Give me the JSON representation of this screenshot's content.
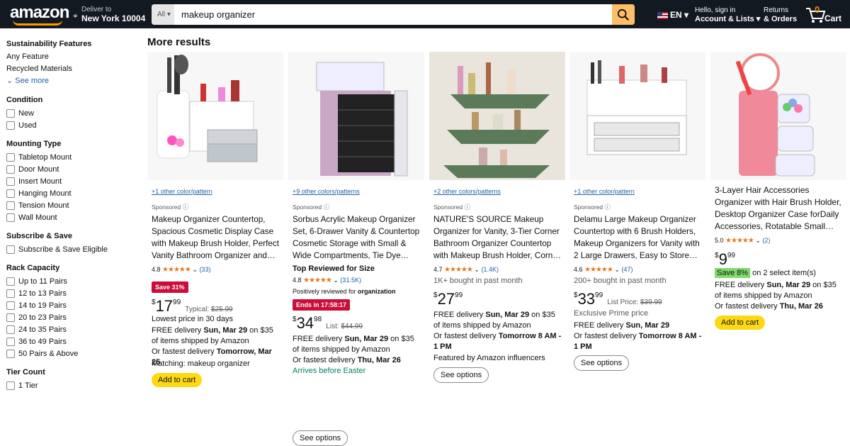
{
  "nav": {
    "logo": "amazon",
    "deliver_l1": "Deliver to",
    "deliver_l2": "New York 10004",
    "search_cat": "All",
    "search_value": "makeup organizer",
    "lang": "EN",
    "account_l1": "Hello, sign in",
    "account_l2": "Account & Lists",
    "returns_l1": "Returns",
    "returns_l2": "& Orders",
    "cart_count": "0",
    "cart_label": "Cart"
  },
  "sidebar": {
    "sustain_title": "Sustainability Features",
    "sustain_opts": [
      "Any Feature",
      "Recycled Materials"
    ],
    "see_more": "See more",
    "condition_title": "Condition",
    "condition_opts": [
      "New",
      "Used"
    ],
    "mount_title": "Mounting Type",
    "mount_opts": [
      "Tabletop Mount",
      "Door Mount",
      "Insert Mount",
      "Hanging Mount",
      "Tension Mount",
      "Wall Mount"
    ],
    "subscribe_title": "Subscribe & Save",
    "subscribe_opts": [
      "Subscribe & Save Eligible"
    ],
    "rack_title": "Rack Capacity",
    "rack_opts": [
      "Up to 11 Pairs",
      "12 to 13 Pairs",
      "14 to 19 Pairs",
      "20 to 23 Pairs",
      "24 to 35 Pairs",
      "36 to 49 Pairs",
      "50 Pairs & Above"
    ],
    "tier_title": "Tier Count",
    "tier_opts": [
      "1 Tier"
    ]
  },
  "main": {
    "heading": "More results",
    "products": [
      {
        "variants": "+1 other color/pattern",
        "sponsored": "Sponsored",
        "title": "Makeup Organizer Countertop, Spacious Cosmetic Display Case with Makeup Brush Holder, Perfect Vanity Bathroom Organizer and…",
        "rating": "4.8",
        "count": "(33)",
        "deal": "Save 31%",
        "price_whole": "17",
        "price_frac": "99",
        "ref_label": "Typical:",
        "ref_price": "$25.99",
        "lowest": "Lowest price in 30 days",
        "delivery1": "FREE delivery ",
        "delivery_date": "Sun, Mar 29",
        "delivery2": " on $35 of items shipped by Amazon",
        "fast1": "Or fastest delivery ",
        "fast_date": "Tomorrow, Mar 25",
        "matching": "Matching: makeup organizer",
        "action": "Add to cart"
      },
      {
        "variants": "+9 other colors/patterns",
        "sponsored": "Sponsored",
        "title": "Sorbus Acrylic Makeup Organizer Set, 6-Drawer Vanity & Countertop Cosmetic Storage with Small & Wide Compartments, Tie Dye…",
        "top_reviewed": "Top Reviewed for Size",
        "rating": "4.8",
        "count": "(31.5K)",
        "positively": "Positively reviewed for ",
        "positively_b": "organization",
        "deal": "Ends in 17:58:17",
        "price_whole": "34",
        "price_frac": "98",
        "ref_label": "List:",
        "ref_price": "$44.99",
        "delivery1": "FREE delivery ",
        "delivery_date": "Sun, Mar 29",
        "delivery2": " on $35 of items shipped by Amazon",
        "fast1": "Or fastest delivery ",
        "fast_date": "Thu, Mar 26",
        "easter": "Arrives before Easter",
        "action": "See options"
      },
      {
        "variants": "+2 other colors/patterns",
        "sponsored": "Sponsored",
        "title": "NATURE'S SOURCE Makeup Organizer for Vanity, 3-Tier Corner Bathroom Organizer Countertop with Makeup Brush Holder, Corn…",
        "rating": "4.7",
        "count": "(1.4K)",
        "bought": "1K+ bought in past month",
        "price_whole": "27",
        "price_frac": "99",
        "delivery1": "FREE delivery ",
        "delivery_date": "Sun, Mar 29",
        "delivery2": " on $35 of items shipped by Amazon",
        "fast1": "Or fastest delivery ",
        "fast_date": "Tomorrow 8 AM - 1 PM",
        "featured": "Featured by Amazon influencers",
        "action": "See options"
      },
      {
        "variants": "+1 other color/pattern",
        "sponsored": "Sponsored",
        "title": "Delamu Large Makeup Organizer Countertop with 6 Brush Holders, Makeup Organizers for Vanity with 2 Large Drawers, Easy to Store…",
        "rating": "4.6",
        "count": "(47)",
        "bought": "200+ bought in past month",
        "price_whole": "33",
        "price_frac": "99",
        "ref_label": "List Price:",
        "ref_price": "$39.99",
        "exclusive": "Exclusive Prime price",
        "delivery1": "FREE delivery ",
        "delivery_date": "Sun, Mar 29",
        "fast1": "Or fastest delivery ",
        "fast_date": "Tomorrow 8 AM - 1 PM",
        "action": "See options"
      },
      {
        "title": "3-Layer Hair Accessories Organizer with Hair Brush Holder, Desktop Organizer Case forDaily Accessories, Rotatable Small…",
        "rating": "5.0",
        "count": "(2)",
        "price_whole": "9",
        "price_frac": "99",
        "save": "Save 8%",
        "save_note": " on 2 select item(s)",
        "delivery1": "FREE delivery ",
        "delivery_date": "Sun, Mar 29",
        "delivery2": " on $35 of items shipped by Amazon",
        "fast1": "Or fastest delivery ",
        "fast_date": "Thu, Mar 26",
        "action": "Add to cart"
      }
    ]
  }
}
